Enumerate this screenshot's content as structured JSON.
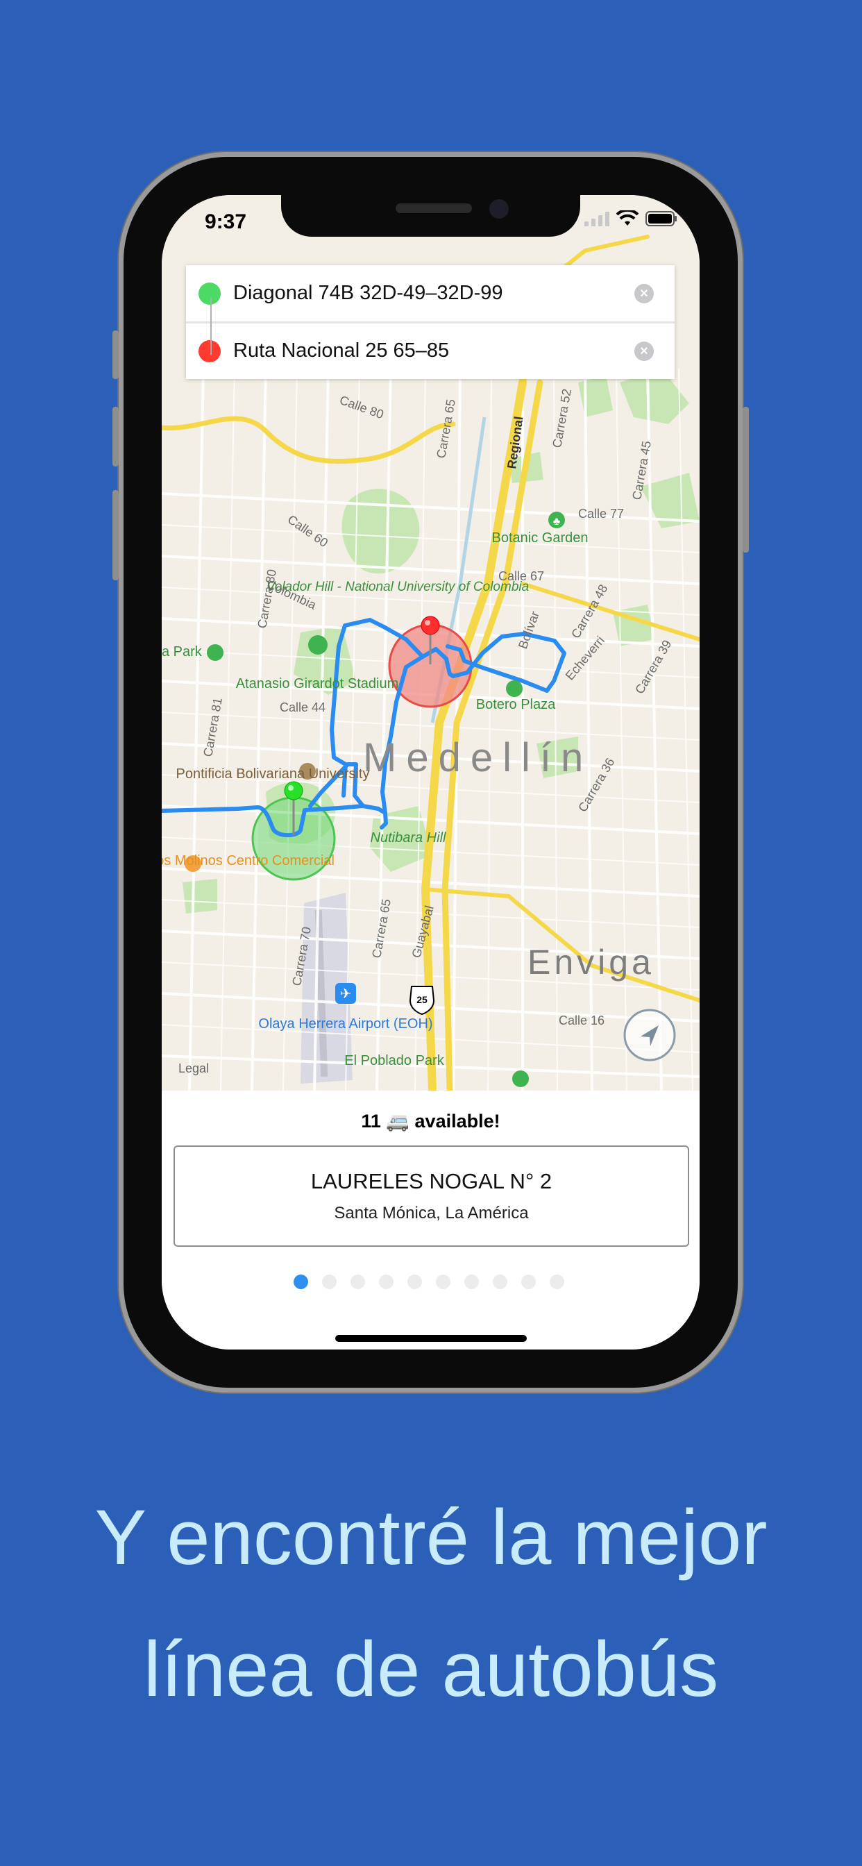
{
  "status_bar": {
    "time": "9:37"
  },
  "search": {
    "origin": "Diagonal 74B 32D-49–32D-99",
    "destination": "Ruta Nacional 25 65–85",
    "origin_color": "#4cd964",
    "destination_color": "#ff3b30"
  },
  "map": {
    "city": "Medellín",
    "labels": {
      "volador": "Volador Hill - National University of Colombia",
      "botanic": "Botanic Garden",
      "atanasio": "Atanasio Girardot Stadium",
      "botero": "Botero Plaza",
      "pontificia": "Pontificia Bolivariana University",
      "nutibara": "Nutibara Hill",
      "molinos": "Los Molinos Centro Comercial",
      "olaya": "Olaya Herrera Airport (EOH)",
      "poblado": "El Poblado Park",
      "park": "a Park",
      "envigado": "Enviga",
      "legal": "Legal",
      "regional": "Regional",
      "shield": "25"
    },
    "streets": {
      "calle60": "Calle 60",
      "calle67": "Calle 67",
      "calle77": "Calle 77",
      "calle44": "Calle 44",
      "calle16": "Calle 16",
      "carrera80": "Carrera 80",
      "carrera81": "Carrera 81",
      "carrera70": "Carrera 70",
      "carrera65a": "Carrera 65",
      "carrera65b": "Carrera 65",
      "carrera52": "Carrera 52",
      "carrera45": "Carrera 45",
      "carrera48": "Carrera 48",
      "carrera39": "Carrera 39",
      "carrera36": "Carrera 36",
      "bolivar": "Bolívar",
      "echeverri": "Echeverri",
      "colombia": "Colombia",
      "guayabal": "Guayabal",
      "calle80": "Calle 80"
    }
  },
  "results": {
    "available": "11 🚐 available!",
    "route_name": "LAURELES NOGAL N° 2",
    "route_area": "Santa Mónica, La América",
    "page_count": 10,
    "active_page": 1
  },
  "caption": {
    "line1": "Y encontré la mejor",
    "line2": "línea de autobús"
  }
}
